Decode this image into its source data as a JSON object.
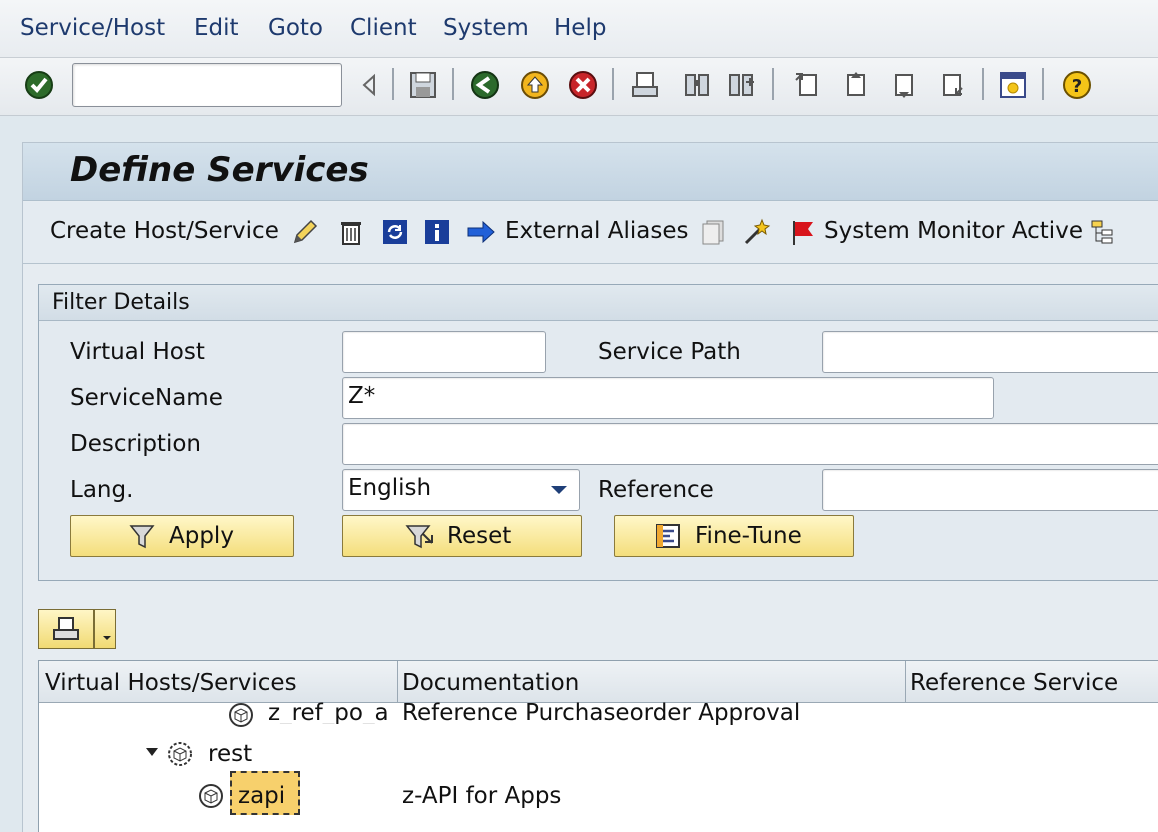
{
  "menubar": {
    "items": [
      "Service/Host",
      "Edit",
      "Goto",
      "Client",
      "System",
      "Help"
    ]
  },
  "toolbar": {
    "command_field_value": "",
    "icons": [
      "enter-icon",
      "back-arrow-icon",
      "save-icon",
      "back-icon",
      "exit-icon",
      "cancel-icon",
      "print-icon",
      "find-icon",
      "find-next-icon",
      "first-page-icon",
      "previous-page-icon",
      "next-page-icon",
      "last-page-icon",
      "layout-icon",
      "help-icon"
    ]
  },
  "page": {
    "title": "Define Services"
  },
  "app_toolbar": {
    "create_label": "Create Host/Service",
    "external_aliases_label": "External Aliases",
    "system_monitor_label": "System Monitor Active"
  },
  "filter": {
    "title": "Filter Details",
    "virtual_host_label": "Virtual Host",
    "virtual_host_value": "",
    "service_path_label": "Service Path",
    "service_path_value": "",
    "service_name_label": "ServiceName",
    "service_name_value": "Z*",
    "description_label": "Description",
    "description_value": "",
    "lang_label": "Lang.",
    "lang_value": "English",
    "reference_label": "Reference",
    "reference_value": "",
    "apply_label": "Apply",
    "reset_label": "Reset",
    "finetune_label": "Fine-Tune"
  },
  "tree": {
    "columns": [
      "Virtual Hosts/Services",
      "Documentation",
      "Reference Service"
    ],
    "rows": [
      {
        "name": "z_ref_po_a",
        "doc": "Reference Purchaseorder Approval"
      },
      {
        "name": "rest",
        "doc": ""
      },
      {
        "name": "zapi",
        "doc": "z-API for Apps"
      }
    ]
  },
  "colors": {
    "button_yellow": "#f4de7c",
    "selection": "#f7d06c",
    "menu_text": "#1e3a6e"
  }
}
